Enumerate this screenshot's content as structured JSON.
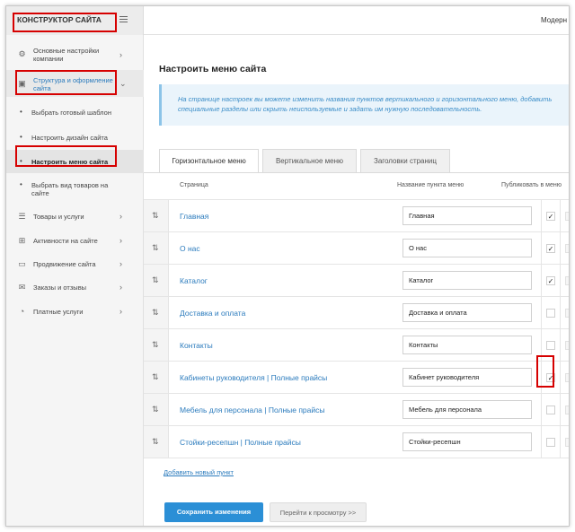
{
  "header": {
    "brand": "КОНСТРУКТОР САЙТА",
    "user": "Модерн"
  },
  "sidebar": {
    "items": [
      {
        "label": "Основные настройки компании",
        "icon": "gear-icon"
      },
      {
        "label": "Структура и оформление сайта",
        "icon": "structure-icon"
      },
      {
        "label": "Товары и услуги",
        "icon": "list-icon"
      },
      {
        "label": "Активности на сайте",
        "icon": "activity-icon"
      },
      {
        "label": "Продвижение сайта",
        "icon": "promo-icon"
      },
      {
        "label": "Заказы и отзывы",
        "icon": "chat-icon"
      },
      {
        "label": "Платные услуги",
        "icon": "coin-icon"
      }
    ],
    "sub": [
      {
        "label": "Выбрать готовый шаблон"
      },
      {
        "label": "Настроить дизайн сайта"
      },
      {
        "label": "Настроить меню сайта"
      },
      {
        "label": "Выбрать вид товаров на сайте"
      }
    ]
  },
  "main": {
    "title": "Настроить меню сайта",
    "info": "На странице настроек вы можете изменить названия пунктов вертикального и горизонтального меню, добавить специальные разделы или скрыть неиспользуемые и задать им нужную последовательность.",
    "tabs": [
      {
        "label": "Горизонтальное меню"
      },
      {
        "label": "Вертикальное меню"
      },
      {
        "label": "Заголовки страниц"
      }
    ],
    "columns": {
      "page": "Страница",
      "name": "Название пункта меню",
      "publish": "Публиковать в меню"
    },
    "rows": [
      {
        "page": "Главная",
        "name": "Главная",
        "check": "✓"
      },
      {
        "page": "О нас",
        "name": "О нас",
        "check": "✓"
      },
      {
        "page": "Каталог",
        "name": "Каталог",
        "check": "✓"
      },
      {
        "page": "Доставка и оплата",
        "name": "Доставка и оплата",
        "check": ""
      },
      {
        "page": "Контакты",
        "name": "Контакты",
        "check": ""
      },
      {
        "page": "Кабинеты руководителя | Полные прайсы",
        "name": "Кабинет руководителя",
        "check": "✓"
      },
      {
        "page": "Мебель для персонала | Полные прайсы",
        "name": "Мебель для персонала",
        "check": ""
      },
      {
        "page": "Стойки-ресепшн | Полные прайсы",
        "name": "Стойки-ресепшн",
        "check": ""
      }
    ],
    "add_link": "Добавить новый пункт",
    "save_label": "Сохранить изменения",
    "preview_label": "Перейти к просмотру >>"
  },
  "colors": {
    "accent": "#2b8fd6",
    "link": "#2b7bbd",
    "highlight": "#d60000"
  }
}
